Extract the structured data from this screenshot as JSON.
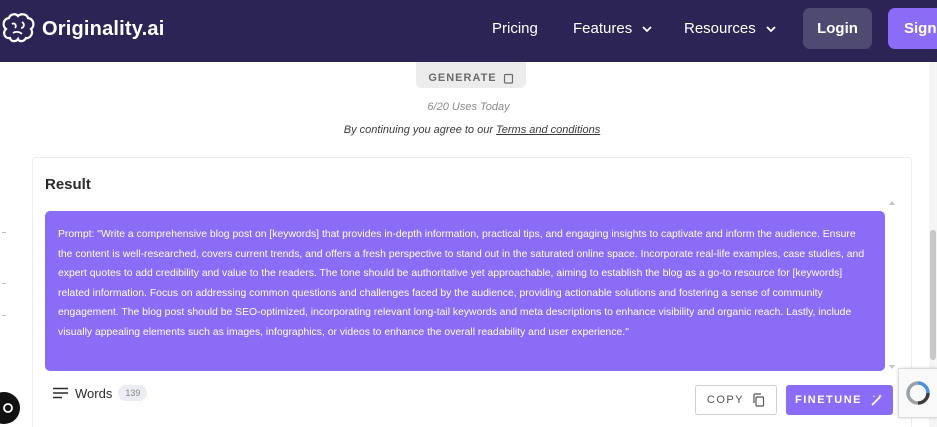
{
  "nav": {
    "brand": "Originality.ai",
    "links": [
      {
        "label": "Pricing",
        "has_dropdown": false
      },
      {
        "label": "Features",
        "has_dropdown": true
      },
      {
        "label": "Resources",
        "has_dropdown": true
      }
    ],
    "login_label": "Login",
    "signup_label": "Sign"
  },
  "generator": {
    "generate_label": "GENERATE",
    "uses_text": "6/20 Uses Today",
    "terms_prefix": "By continuing you agree to our ",
    "terms_link": "Terms and conditions"
  },
  "result": {
    "title": "Result",
    "prompt_text": "Prompt: \"Write a comprehensive blog post on [keywords] that provides in-depth information, practical tips, and engaging insights to captivate and inform the audience. Ensure the content is well-researched, covers current trends, and offers a fresh perspective to stand out in the saturated online space. Incorporate real-life examples, case studies, and expert quotes to add credibility and value to the readers. The tone should be authoritative yet approachable, aiming to establish the blog as a go-to resource for [keywords] related information. Focus on addressing common questions and challenges faced by the audience, providing actionable solutions and fostering a sense of community engagement. The blog post should be SEO-optimized, incorporating relevant long-tail keywords and meta descriptions to enhance visibility and organic reach. Lastly, include visually appealing elements such as images, infographics, or videos to enhance the overall readability and user experience.\"",
    "words_label": "Words",
    "word_count": "139",
    "copy_label": "COPY",
    "finetune_label": "FINETUNE"
  },
  "colors": {
    "nav_bg": "#2d2456",
    "accent": "#8b6cf7",
    "login_bg": "#4f4a72"
  },
  "icons": [
    "brain-logo-icon",
    "chevron-down-icon",
    "clipboard-icon",
    "copy-icon",
    "magic-wand-icon",
    "menu-lines-icon",
    "recaptcha-icon",
    "chat-icon"
  ]
}
